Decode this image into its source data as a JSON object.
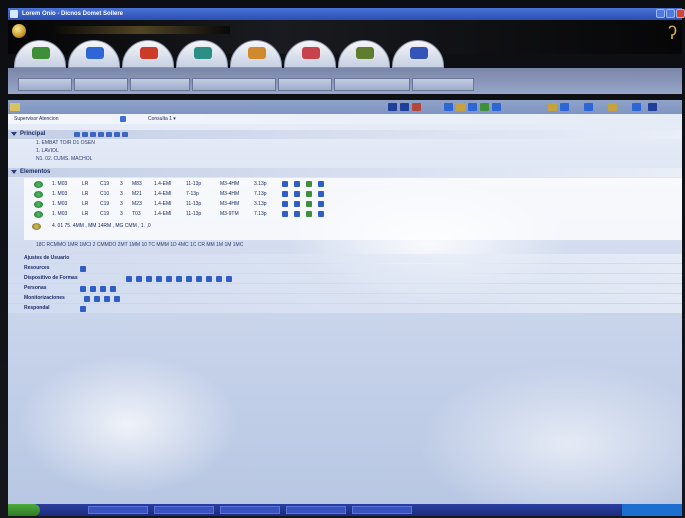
{
  "window": {
    "title": "Lorem Onio - Dicnos Domet Sollere",
    "buttons": {
      "minimize": "minimize",
      "maximize": "maximize",
      "close": "close"
    }
  },
  "header": {
    "logo_icon": "globe-icon",
    "brand_glyph": "ʔ"
  },
  "modules": [
    {
      "name": "module-1",
      "color": "#3f8f3a"
    },
    {
      "name": "module-2",
      "color": "#2e66d6"
    },
    {
      "name": "module-3",
      "color": "#cc3b2a"
    },
    {
      "name": "module-4",
      "color": "#2c8f86"
    },
    {
      "name": "module-5",
      "color": "#d0892e"
    },
    {
      "name": "module-6",
      "color": "#c9414a"
    },
    {
      "name": "module-7",
      "color": "#5f7d2e"
    },
    {
      "name": "module-8",
      "color": "#3554b8"
    }
  ],
  "nav_tabs": [
    {
      "label": ""
    },
    {
      "label": ""
    },
    {
      "label": ""
    },
    {
      "label": ""
    },
    {
      "label": ""
    },
    {
      "label": ""
    },
    {
      "label": ""
    }
  ],
  "filter": {
    "label": "Supervisor Atencion",
    "right": "Consulta  1 ▾"
  },
  "principal": {
    "label": "Principal",
    "lines": [
      "1. EMBAT TOIR D1 OSEN",
      "1. LAVIOL",
      "N1. 02. CUMS. MACHOL"
    ]
  },
  "elementos": {
    "label": "Elementos",
    "rows": [
      {
        "c1": "1. M03",
        "c2": "LR",
        "c3": "C19",
        "c4": "3",
        "c5": "M83",
        "c6": "1.4-EMI",
        "c7": "11-13p",
        "c8": "M3-4HM",
        "c9": "3.13p"
      },
      {
        "c1": "1. M03",
        "c2": "LR",
        "c3": "C10",
        "c4": "3",
        "c5": "M21",
        "c6": "1.4-EMI",
        "c7": "7-13p",
        "c8": "M3-4HM",
        "c9": "7.13p"
      },
      {
        "c1": "1. M03",
        "c2": "LR",
        "c3": "C19",
        "c4": "3",
        "c5": "M23",
        "c6": "1.4-EMI",
        "c7": "11-13p",
        "c8": "M3-4HM",
        "c9": "3.13p"
      },
      {
        "c1": "1. M03",
        "c2": "LR",
        "c3": "C19",
        "c4": "3",
        "c5": "T03",
        "c6": "1.4-EMI",
        "c7": "11-13p",
        "c8": "M3-9TM",
        "c9": "7.13p"
      }
    ],
    "summary": "4. 01   75. 4MM   ,  MM 14RM  ,   MG CMM  ,  1.   ,0",
    "legend": "18C RCMMO   1MR 1MCI 2 CMMDO   2MT 1MM   10 TC MMM   1D 4MC  1C CR   MM 1M   1M 1MC"
  },
  "props": [
    {
      "label": "Ajustes de Usuario",
      "icons": []
    },
    {
      "label": "Resources",
      "icons": [
        "#2f5fc6"
      ]
    },
    {
      "label": "Dispositivo de Formas",
      "icons": [
        "#2f5fc6",
        "#2f5fc6",
        "#2f5fc6",
        "#2f5fc6",
        "#2f5fc6",
        "#2f5fc6",
        "#2f5fc6",
        "#2f5fc6",
        "#2f5fc6",
        "#2f5fc6",
        "#2f5fc6"
      ]
    },
    {
      "label": "Personas",
      "icons": [
        "#2f5fc6",
        "#2f5fc6",
        "#2f5fc6",
        "#2f5fc6"
      ]
    },
    {
      "label": "Monitorizaciones",
      "icons": [
        "#2f5fc6",
        "#2f5fc6",
        "#2f5fc6",
        "#2f5fc6"
      ]
    },
    {
      "label": "Respondal",
      "icons": [
        "#2f5fc6"
      ]
    }
  ],
  "taskbar": {
    "buttons": [
      "",
      "",
      "",
      "",
      "",
      ""
    ]
  }
}
